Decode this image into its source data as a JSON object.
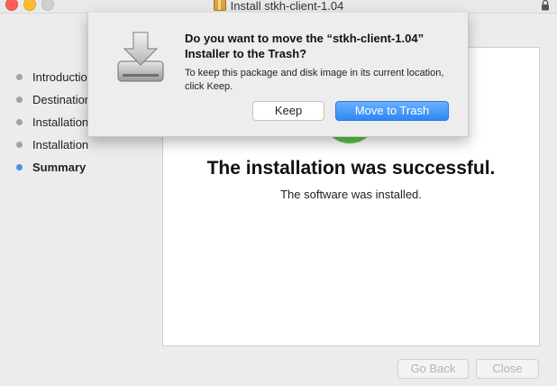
{
  "window": {
    "title": "Install stkh-client-1.04"
  },
  "sidebar": {
    "steps": [
      {
        "label": "Introduction",
        "state": "done"
      },
      {
        "label": "Destination Select",
        "state": "done"
      },
      {
        "label": "Installation Type",
        "state": "done"
      },
      {
        "label": "Installation",
        "state": "done"
      },
      {
        "label": "Summary",
        "state": "active"
      }
    ]
  },
  "main": {
    "headline": "The installation was successful.",
    "subline": "The software was installed."
  },
  "footer": {
    "go_back": "Go Back",
    "close": "Close"
  },
  "dialog": {
    "title": "Do you want to move the “stkh-client-1.04” Installer to the Trash?",
    "message": "To keep this package and disk image in its current location, click Keep.",
    "keep_label": "Keep",
    "trash_label": "Move to Trash"
  },
  "colors": {
    "accent": "#2f86f5",
    "success": "#5dc44b",
    "active_step": "#4a90e2"
  },
  "icons": [
    "package-icon",
    "lock-icon",
    "installer-icon",
    "success-check-icon"
  ]
}
